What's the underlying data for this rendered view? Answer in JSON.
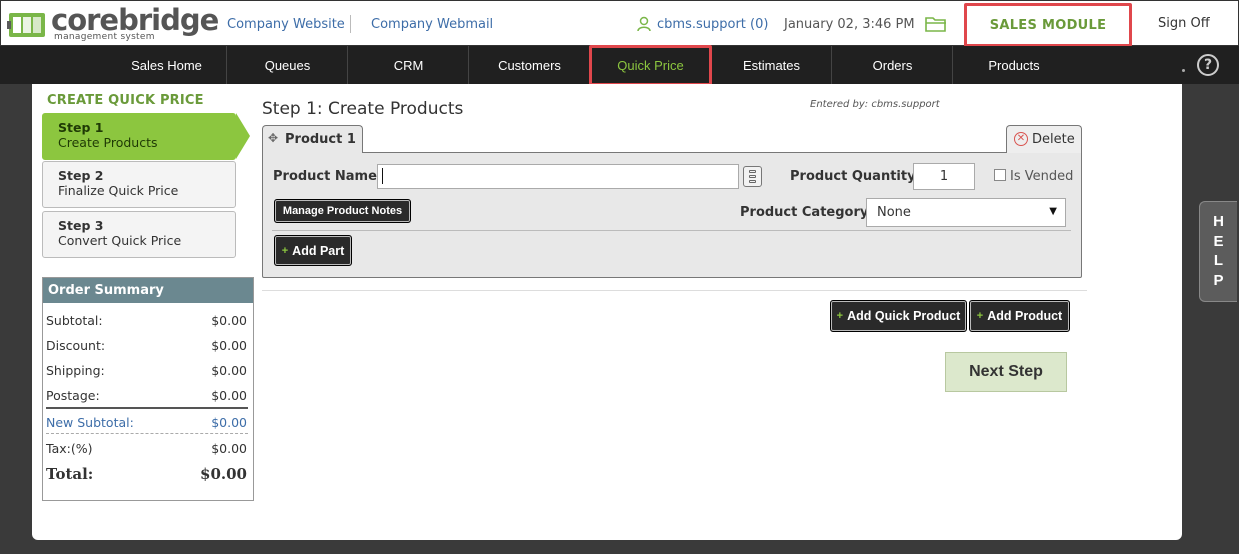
{
  "header": {
    "logo_text": "corebridge",
    "logo_sub": "management system",
    "company_website": "Company Website",
    "company_webmail": "Company Webmail",
    "user": "cbms.support (0)",
    "datetime": "January 02, 3:46 PM",
    "module": "SALES MODULE",
    "sign_off": "Sign Off"
  },
  "nav": {
    "items": [
      "Sales Home",
      "Queues",
      "CRM",
      "Customers",
      "Quick Price",
      "Estimates",
      "Orders",
      "Products"
    ],
    "active": "Quick Price",
    "help": "?"
  },
  "sidebar": {
    "title": "CREATE QUICK PRICE",
    "steps": [
      {
        "title": "Step 1",
        "subtitle": "Create Products"
      },
      {
        "title": "Step 2",
        "subtitle": "Finalize Quick Price"
      },
      {
        "title": "Step 3",
        "subtitle": "Convert Quick Price"
      }
    ]
  },
  "summary": {
    "title": "Order Summary",
    "rows": [
      {
        "label": "Subtotal:",
        "value": "$0.00"
      },
      {
        "label": "Discount:",
        "value": "$0.00"
      },
      {
        "label": "Shipping:",
        "value": "$0.00"
      },
      {
        "label": "Postage:",
        "value": "$0.00"
      },
      {
        "label": "New Subtotal:",
        "value": "$0.00"
      },
      {
        "label": "Tax:(%)",
        "value": "$0.00"
      },
      {
        "label": "Total:",
        "value": "$0.00"
      }
    ]
  },
  "main": {
    "heading": "Step 1: Create Products",
    "entered_by": "Entered by: cbms.support",
    "product_tab": "Product 1",
    "delete_label": "Delete",
    "product_name_label": "Product Name:",
    "product_name_value": "",
    "product_quantity_label": "Product Quantity:",
    "product_quantity_value": "1",
    "is_vended_label": "Is Vended",
    "manage_notes_label": "Manage Product Notes",
    "product_category_label": "Product Category:",
    "product_category_value": "None",
    "add_part_label": "Add Part",
    "add_quick_product_label": "Add Quick Product",
    "add_product_label": "Add Product",
    "next_step_label": "Next Step"
  },
  "help_tab": [
    "H",
    "E",
    "L",
    "P"
  ],
  "colors": {
    "accent_green": "#8cc63f",
    "nav_bg": "#202020",
    "highlight_red": "#e0474c",
    "link_blue": "#3d6da8"
  }
}
